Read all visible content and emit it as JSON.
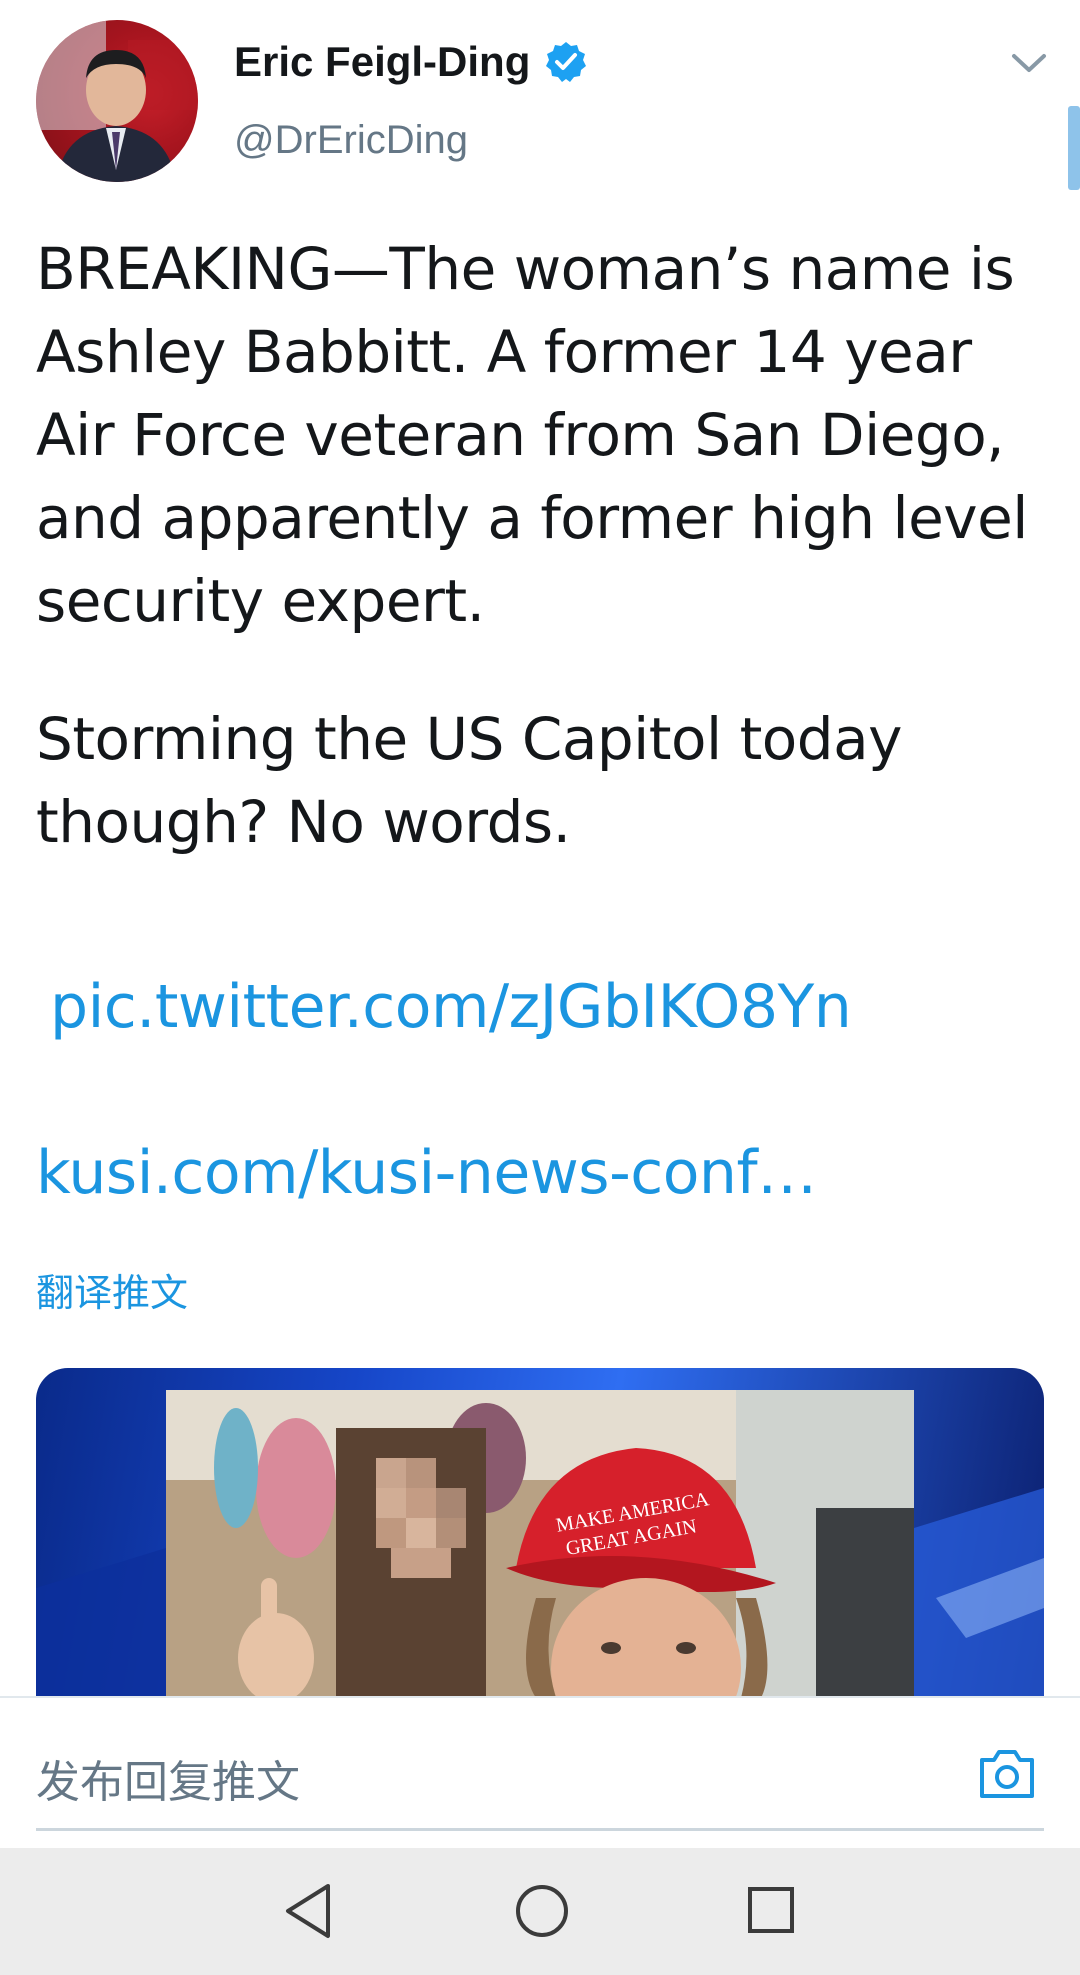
{
  "header": {
    "display_name": "Eric Feigl-Ding",
    "handle": "@DrEricDing",
    "verified": true
  },
  "tweet": {
    "paragraph_1": "BREAKING—The woman’s name is Ashley Babbitt. A former 14 year Air Force veteran from San Diego, and apparently a former high level security expert.",
    "paragraph_2": "Storming the US Capitol today though? No words.",
    "pic_link": "pic.twitter.com/zJGbIKO8Yn",
    "external_link": "kusi.com/kusi-news-conf…",
    "translate_label": "翻译推文"
  },
  "media": {
    "hat_text_line1": "MAKE AMERICA",
    "hat_text_line2": "GREAT AGAIN"
  },
  "reply": {
    "placeholder": "发布回复推文"
  },
  "colors": {
    "link": "#1b95e0",
    "verified": "#1da1f2",
    "secondary_text": "#657786",
    "nav_bar": "#ececec"
  },
  "icons": {
    "verified": "verified-badge-icon",
    "chevron": "chevron-down-icon",
    "camera": "camera-icon",
    "back": "nav-back-icon",
    "home": "nav-home-icon",
    "recents": "nav-recents-icon"
  }
}
